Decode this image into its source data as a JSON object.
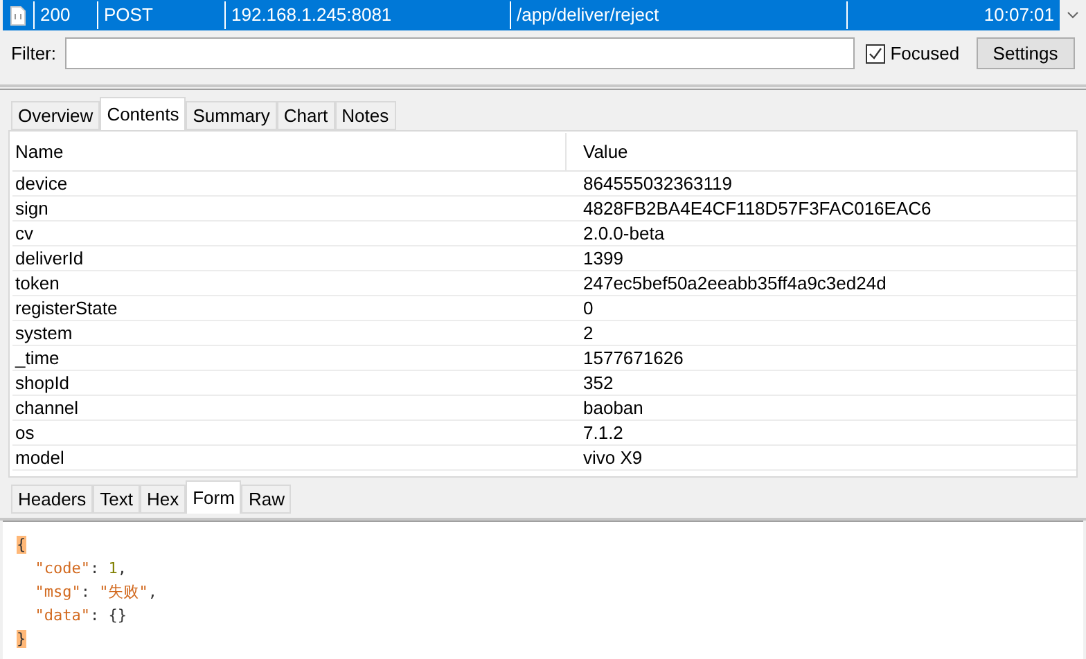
{
  "session": {
    "status": "200",
    "method": "POST",
    "host": "192.168.1.245:8081",
    "path": "/app/deliver/reject",
    "time": "10:07:01",
    "selected": true
  },
  "filter": {
    "label": "Filter:",
    "focused_label": "Focused",
    "focused_checked": true,
    "settings_button": "Settings"
  },
  "tabs": [
    {
      "label": "Overview",
      "selected": false
    },
    {
      "label": "Contents",
      "selected": true
    },
    {
      "label": "Summary",
      "selected": false
    },
    {
      "label": "Chart",
      "selected": false
    },
    {
      "label": "Notes",
      "selected": false
    }
  ],
  "table": {
    "columns": [
      "Name",
      "Value"
    ],
    "rows": [
      {
        "name": "device",
        "value": "864555032363119"
      },
      {
        "name": "sign",
        "value": "4828FB2BA4E4CF118D57F3FAC016EAC6"
      },
      {
        "name": "cv",
        "value": "2.0.0-beta"
      },
      {
        "name": "deliverId",
        "value": "1399"
      },
      {
        "name": "token",
        "value": "247ec5bef50a2eeabb35ff4a9c3ed24d"
      },
      {
        "name": "registerState",
        "value": "0"
      },
      {
        "name": "system",
        "value": "2"
      },
      {
        "name": "_time",
        "value": "1577671626"
      },
      {
        "name": "shopId",
        "value": "352"
      },
      {
        "name": "channel",
        "value": "baoban"
      },
      {
        "name": "os",
        "value": "7.1.2"
      },
      {
        "name": "model",
        "value": "vivo X9"
      }
    ]
  },
  "response_tabs": [
    {
      "label": "Headers",
      "selected": false
    },
    {
      "label": "Text",
      "selected": false
    },
    {
      "label": "Hex",
      "selected": false
    },
    {
      "label": "Form",
      "selected": true
    },
    {
      "label": "Raw",
      "selected": false
    }
  ],
  "response_body": [
    [
      {
        "text": "{",
        "kind": "bracket",
        "highlighted": true
      }
    ],
    [
      {
        "text": "  \"code\"",
        "kind": "key"
      },
      {
        "text": ": ",
        "kind": "punct"
      },
      {
        "text": "1",
        "kind": "number"
      },
      {
        "text": ",",
        "kind": "punct"
      }
    ],
    [
      {
        "text": "  \"msg\"",
        "kind": "key"
      },
      {
        "text": ": ",
        "kind": "punct"
      },
      {
        "text": "\"失败\"",
        "kind": "string"
      },
      {
        "text": ",",
        "kind": "punct"
      }
    ],
    [
      {
        "text": "  \"data\"",
        "kind": "key"
      },
      {
        "text": ": ",
        "kind": "punct"
      },
      {
        "text": "{}",
        "kind": "bracket",
        "highlighted": false
      }
    ],
    [
      {
        "text": "}",
        "kind": "bracket",
        "highlighted": true
      }
    ]
  ]
}
